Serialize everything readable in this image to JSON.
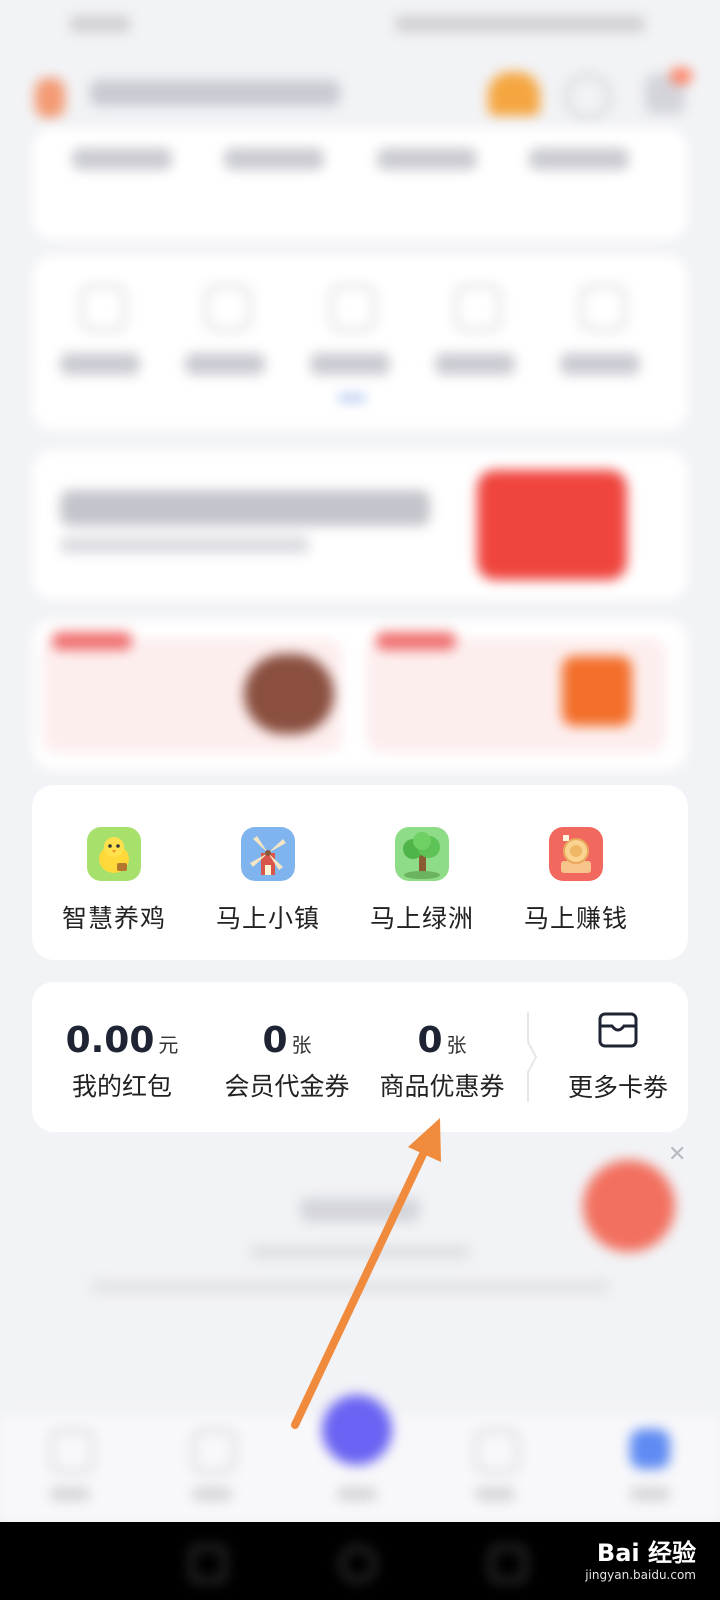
{
  "apps": [
    {
      "label": "智慧养鸡",
      "icon": "chick-icon",
      "color": "#a7e06a"
    },
    {
      "label": "马上小镇",
      "icon": "windmill-icon",
      "color": "#7fb4ef"
    },
    {
      "label": "马上绿洲",
      "icon": "tree-icon",
      "color": "#8fdc88"
    },
    {
      "label": "马上赚钱",
      "icon": "coin-icon",
      "color": "#f1685f"
    }
  ],
  "coupons": [
    {
      "value": "0.00",
      "unit": "元",
      "label": "我的红包"
    },
    {
      "value": "0",
      "unit": "张",
      "label": "会员代金券"
    },
    {
      "value": "0",
      "unit": "张",
      "label": "商品优惠券"
    }
  ],
  "more_cards": {
    "label": "更多卡劵",
    "icon": "wallet-icon"
  },
  "annotation": {
    "color": "#f08a3c"
  },
  "watermark": {
    "brand": "Bai 经验",
    "url": "jingyan.baidu.com"
  }
}
